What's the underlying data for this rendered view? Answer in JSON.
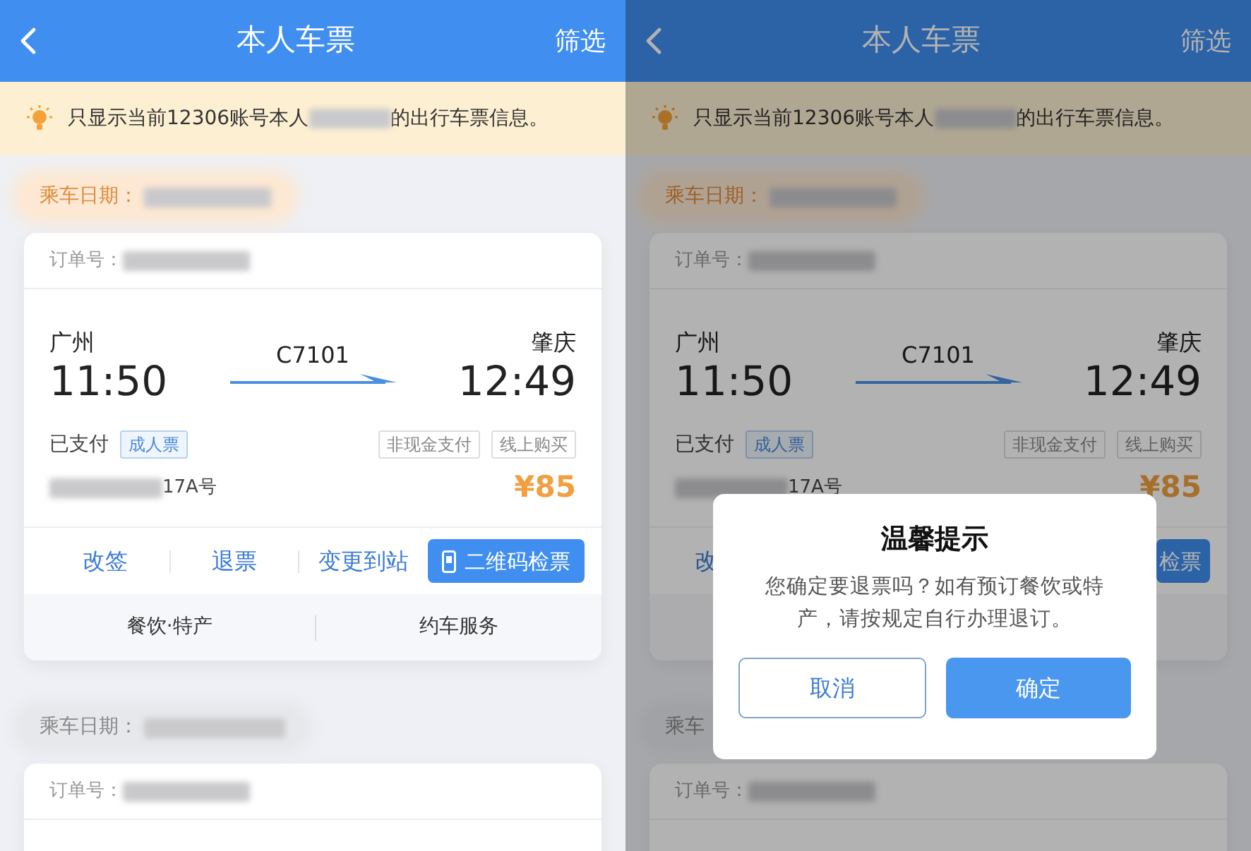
{
  "screens": [
    {
      "header": {
        "title": "本人车票",
        "action": "筛选"
      },
      "notice": {
        "before": "只显示当前12306账号本人",
        "after": "的出行车票信息。"
      },
      "trips": [
        {
          "date_label": "乘车日期：",
          "highlighted": true,
          "order_label": "订单号：",
          "from": "广州",
          "depart": "11:50",
          "train": "C7101",
          "to": "肇庆",
          "arrive": "12:49",
          "status": "已支付",
          "ticket_type": "成人票",
          "tags": [
            "非现金支付",
            "线上购买"
          ],
          "seat": "17A号",
          "price": "¥85",
          "actions": [
            {
              "label": "改签",
              "kind": "link"
            },
            {
              "label": "退票",
              "kind": "link"
            },
            {
              "label": "变更到站",
              "kind": "link"
            },
            {
              "label": "二维码检票",
              "kind": "primary"
            }
          ],
          "services": [
            "餐饮·特产",
            "约车服务"
          ]
        },
        {
          "date_label": "乘车日期：",
          "highlighted": false,
          "order_label": "订单号："
        }
      ]
    },
    {
      "header": {
        "title": "本人车票",
        "action": "筛选"
      },
      "notice": {
        "before": "只显示当前12306账号本人",
        "after": "的出行车票信息。"
      },
      "trips": [
        {
          "date_label": "乘车日期：",
          "highlighted": true,
          "order_label": "订单号：",
          "from": "广州",
          "depart": "11:50",
          "train": "C7101",
          "to": "肇庆",
          "arrive": "12:49",
          "status": "已支付",
          "ticket_type": "成人票",
          "tags": [
            "非现金支付",
            "线上购买"
          ],
          "seat": "17A号",
          "price": "¥85",
          "actions": [
            {
              "label": "改",
              "kind": "link"
            },
            {
              "label": "检票",
              "kind": "primary"
            }
          ]
        },
        {
          "date_label": "乘车",
          "highlighted": false,
          "order_label": "订单号："
        }
      ],
      "dialog": {
        "title": "温馨提示",
        "message": "您确定要退票吗？如有预订餐饮或特产，请按规定自行办理退订。",
        "buttons": [
          {
            "label": "取消",
            "kind": "outline"
          },
          {
            "label": "确定",
            "kind": "primary"
          }
        ]
      }
    }
  ]
}
